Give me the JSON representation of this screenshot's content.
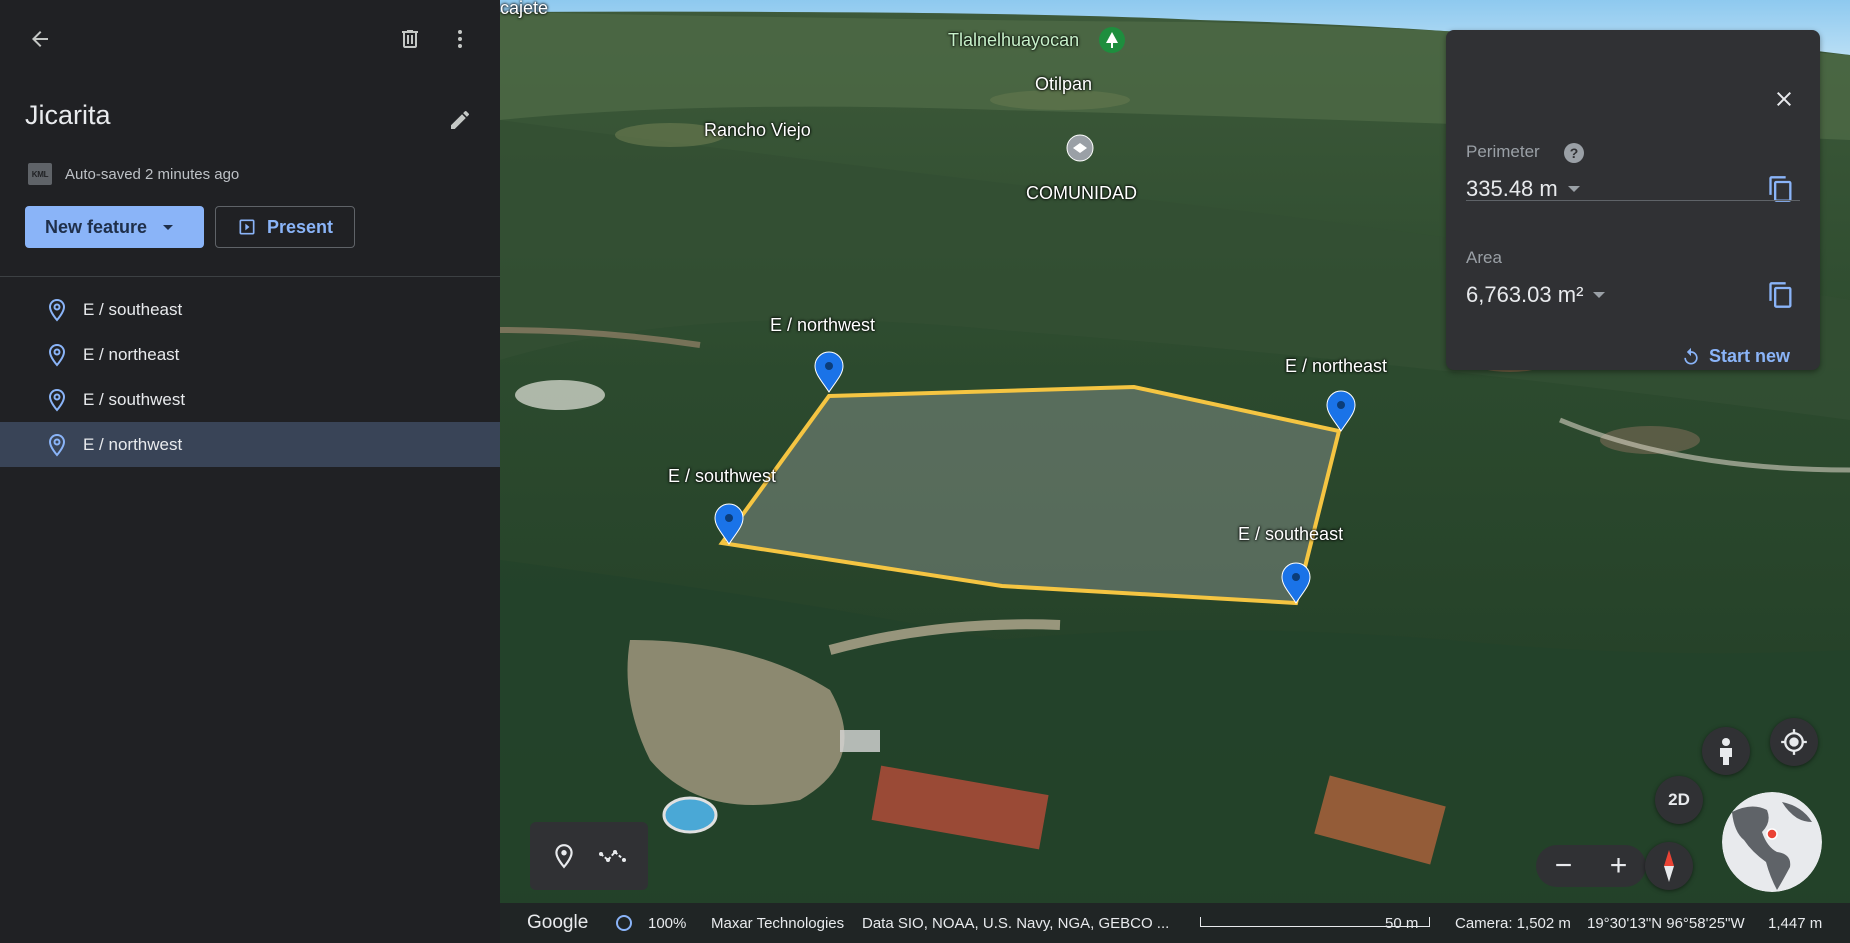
{
  "sidebar": {
    "title": "Jicarita",
    "autosave_badge": "KML",
    "autosave_text": "Auto-saved 2 minutes ago",
    "new_feature_label": "New feature",
    "present_label": "Present",
    "features": [
      {
        "label": "E / southeast",
        "selected": false
      },
      {
        "label": "E / northeast",
        "selected": false
      },
      {
        "label": "E / southwest",
        "selected": false
      },
      {
        "label": "E / northwest",
        "selected": true
      }
    ]
  },
  "map": {
    "place_labels": {
      "cajete": "cajete",
      "tlalnelhuayocan": "Tlalnelhuayocan",
      "otilpan": "Otilpan",
      "rancho_viejo": "Rancho Viejo",
      "comunidad": "COMUNIDAD"
    },
    "pins": {
      "northwest": "E / northwest",
      "northeast": "E / northeast",
      "southwest": "E / southwest",
      "southeast": "E / southeast"
    },
    "polygon_color": "#f5c542",
    "pin_color": "#1a73e8"
  },
  "measure": {
    "perimeter_label": "Perimeter",
    "perimeter_help": "?",
    "perimeter_value": "335.48 m",
    "area_label": "Area",
    "area_value": "6,763.03 m²",
    "start_new_label": "Start new"
  },
  "controls": {
    "view_2d_label": "2D",
    "zoom_out": "−",
    "zoom_in": "+"
  },
  "status": {
    "google": "Google",
    "progress": "100%",
    "provider": "Maxar Technologies",
    "data_sources": "Data SIO, NOAA, U.S. Navy, NGA, GEBCO ...",
    "scale": "50 m",
    "camera": "Camera: 1,502 m",
    "coords": "19°30'13\"N 96°58'25\"W",
    "elevation": "1,447 m"
  }
}
